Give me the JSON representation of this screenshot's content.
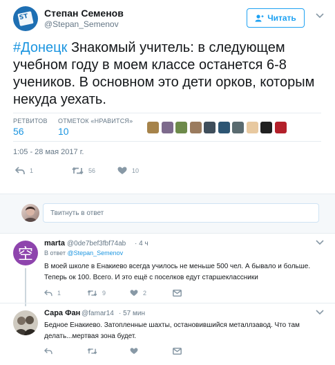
{
  "author": {
    "display_name": "Степан Семенов",
    "handle": "@Stepan_Semenov",
    "avatar_logo_text": "ST"
  },
  "follow_button": {
    "label": "Читать"
  },
  "tweet": {
    "hashtag": "#Донецк",
    "text": " Знакомый учитель: в следующем учебном году в моем классе останется 6-8 учеников. В основном это дети орков, которым некуда уехать.",
    "retweets_label": "РЕТВИТОВ",
    "retweets_count": "56",
    "likes_label": "ОТМЕТОК «НРАВИТСЯ»",
    "likes_count": "10",
    "timestamp": "1:05 - 28 мая 2017 г.",
    "actions": {
      "reply_count": "1",
      "retweet_count": "56",
      "like_count": "10"
    },
    "liker_colors": [
      "#a6834a",
      "#7d6a8c",
      "#6d8a4a",
      "#9a7b5e",
      "#3f4e5b",
      "#2d5573",
      "#5a6b70",
      "#e8c9a0",
      "#202020",
      "#b3202a"
    ]
  },
  "reply_box": {
    "placeholder": "Твитнуть в ответ"
  },
  "replies": [
    {
      "display_name": "marta",
      "handle": "@0de7bef3fbf74ab",
      "time": "· 4 ч",
      "reply_to_prefix": "В ответ",
      "reply_to_handle": "@Stepan_Semenov",
      "text": "В моей школе в Енакиево всегда училось не меньше 500 чел. А бывало и больше. Теперь ок 100. Всего. И это ещё с поселков едут старшеклассники",
      "reply_count": "1",
      "retweet_count": "9",
      "like_count": "2",
      "avatar_char": "空",
      "avatar_color": "#8e44ad"
    },
    {
      "display_name": "Сара Фан",
      "handle": "@famar14",
      "time": "· 57 мин",
      "text": "Бедное Енакиево. Затопленные шахты, остановившийся металлзавод. Что там делать...мертвая зона будет.",
      "reply_count": "",
      "retweet_count": "",
      "like_count": ""
    }
  ]
}
